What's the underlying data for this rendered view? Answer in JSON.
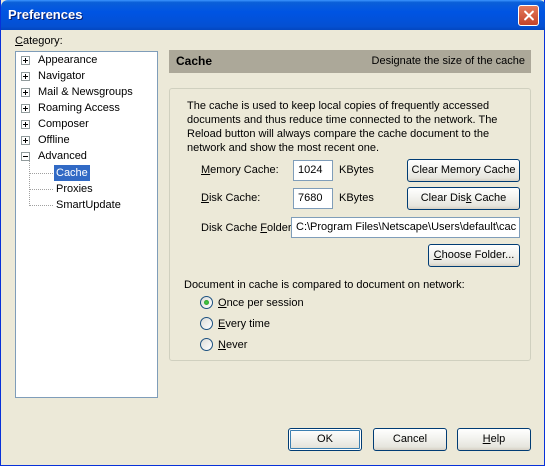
{
  "window": {
    "title": "Preferences"
  },
  "category_label": "Category:",
  "tree": [
    {
      "label": "Appearance",
      "expander": "plus"
    },
    {
      "label": "Navigator",
      "expander": "plus"
    },
    {
      "label": "Mail & Newsgroups",
      "expander": "plus"
    },
    {
      "label": "Roaming Access",
      "expander": "plus"
    },
    {
      "label": "Composer",
      "expander": "plus"
    },
    {
      "label": "Offline",
      "expander": "plus"
    },
    {
      "label": "Advanced",
      "expander": "minus"
    },
    {
      "label": "Cache",
      "selected": true
    },
    {
      "label": "Proxies"
    },
    {
      "label": "SmartUpdate"
    }
  ],
  "header": {
    "title": "Cache",
    "description": "Designate the size of the cache"
  },
  "description": "The cache is used to keep local copies of frequently accessed documents and thus reduce time connected to the network. The Reload button will always compare the cache document to the network and show the most recent one.",
  "memory_cache": {
    "label": "Memory Cache:",
    "value": "1024",
    "unit": "KBytes",
    "clear_button": "Clear Memory Cache"
  },
  "disk_cache": {
    "label": "Disk Cache:",
    "value": "7680",
    "unit": "KBytes",
    "clear_button": "Clear Disk Cache"
  },
  "disk_cache_folder": {
    "label": "Disk Cache Folder:",
    "value": "C:\\Program Files\\Netscape\\Users\\default\\cac"
  },
  "choose_folder_button": "Choose Folder...",
  "compare": {
    "question": "Document in cache is compared to document on network:",
    "options": [
      {
        "label": "Once per session",
        "checked": true
      },
      {
        "label": "Every time",
        "checked": false
      },
      {
        "label": "Never",
        "checked": false
      }
    ]
  },
  "footer": {
    "ok": "OK",
    "cancel": "Cancel",
    "help": "Help"
  },
  "colors": {
    "titlebar": "#0054e3",
    "selection": "#316ac5",
    "header_bar": "#aca899",
    "dialog_bg": "#ece9d8"
  }
}
